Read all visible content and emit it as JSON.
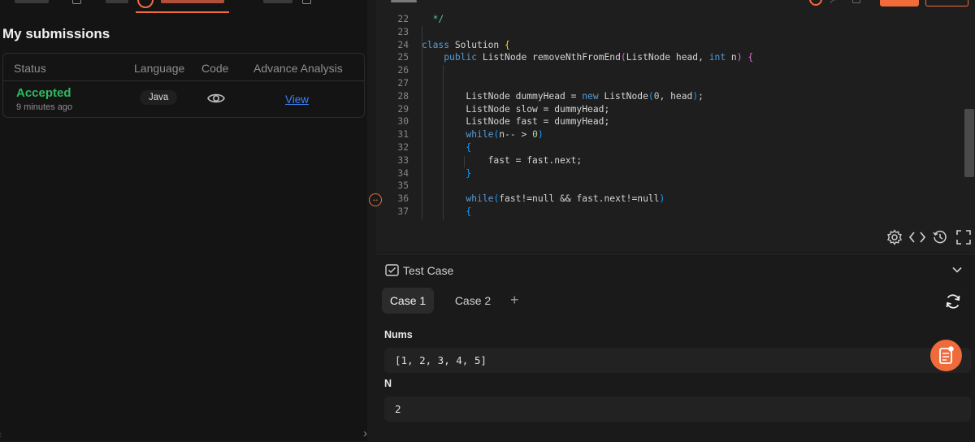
{
  "submissions": {
    "title": "My submissions",
    "columns": [
      "Status",
      "Language",
      "Code",
      "Advance Analysis"
    ],
    "rows": [
      {
        "status": "Accepted",
        "time": "9 minutes ago",
        "language": "Java",
        "link": "View"
      }
    ]
  },
  "editor": {
    "lines": [
      {
        "num": "22",
        "html": "  <span class='ty'>*/</span>"
      },
      {
        "num": "23",
        "html": ""
      },
      {
        "num": "24",
        "html": "<span class='kw'>class</span> Solution <span class='br1'>{</span>"
      },
      {
        "num": "25",
        "html": "    <span class='kw'>public</span> ListNode removeNthFromEnd<span class='br2'>(</span>ListNode head, <span class='kw'>int</span> n<span class='br2'>)</span> <span class='br2'>{</span>"
      },
      {
        "num": "26",
        "html": ""
      },
      {
        "num": "27",
        "html": ""
      },
      {
        "num": "28",
        "html": "        ListNode dummyHead = <span class='kw'>new</span> ListNode<span class='br3'>(</span><span class='nu'>0</span>, head<span class='br3'>)</span>;"
      },
      {
        "num": "29",
        "html": "        ListNode slow = dummyHead;"
      },
      {
        "num": "30",
        "html": "        ListNode fast = dummyHead;"
      },
      {
        "num": "31",
        "html": "        <span class='kw'>while</span><span class='br3'>(</span>n-- &gt; <span class='nu'>0</span><span class='br3'>)</span>"
      },
      {
        "num": "32",
        "html": "        <span class='br3'>{</span>"
      },
      {
        "num": "33",
        "html": "            fast = fast.next;"
      },
      {
        "num": "34",
        "html": "        <span class='br3'>}</span>"
      },
      {
        "num": "35",
        "html": ""
      },
      {
        "num": "36",
        "html": "        <span class='kw'>while</span><span class='br3'>(</span>fast!=null &amp;&amp; fast.next!=null<span class='br3'>)</span>"
      },
      {
        "num": "37",
        "html": "        <span class='br3'>{</span>"
      }
    ]
  },
  "testcase": {
    "title": "Test Case",
    "tabs": [
      "Case 1",
      "Case 2"
    ],
    "add_label": "+",
    "fields": [
      {
        "label": "Nums",
        "value": "[1, 2, 3, 4, 5]"
      },
      {
        "label": "N",
        "value": "2"
      }
    ]
  },
  "colors": {
    "accent": "#f26b3a",
    "accepted": "#2cbb5d",
    "link": "#3b82f6"
  },
  "icons": [
    "eye-icon",
    "settings-icon",
    "code-icon",
    "history-icon",
    "fullscreen-icon",
    "checklist-icon",
    "chevron-down-icon",
    "reset-icon",
    "notes-icon",
    "resize-handle-icon"
  ]
}
